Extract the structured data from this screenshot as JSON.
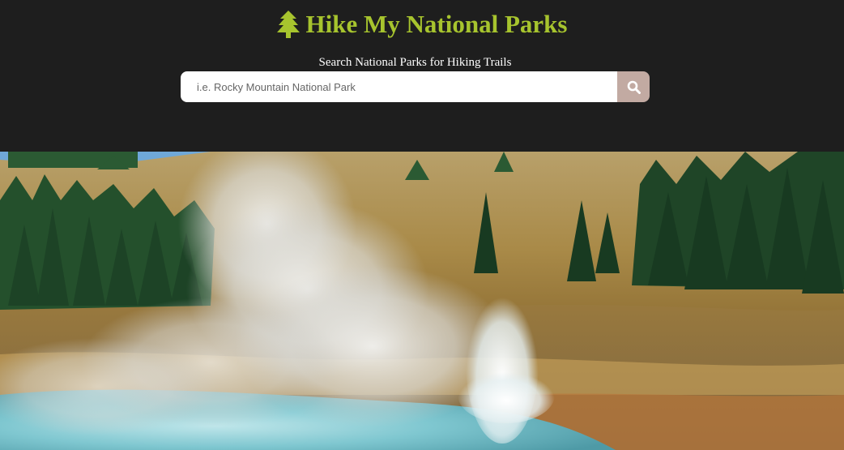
{
  "header": {
    "title": "Hike My National Parks",
    "brand_icon": "pine-tree-icon",
    "brand_color": "#a7c42e",
    "background_color": "#1e1e1e"
  },
  "search": {
    "label": "Search National Parks for Hiking Trails",
    "placeholder": "i.e. Rocky Mountain National Park",
    "value": "",
    "button_icon": "search-icon",
    "button_color": "#c2aaa2"
  },
  "hero": {
    "image": "geyser-landscape"
  }
}
